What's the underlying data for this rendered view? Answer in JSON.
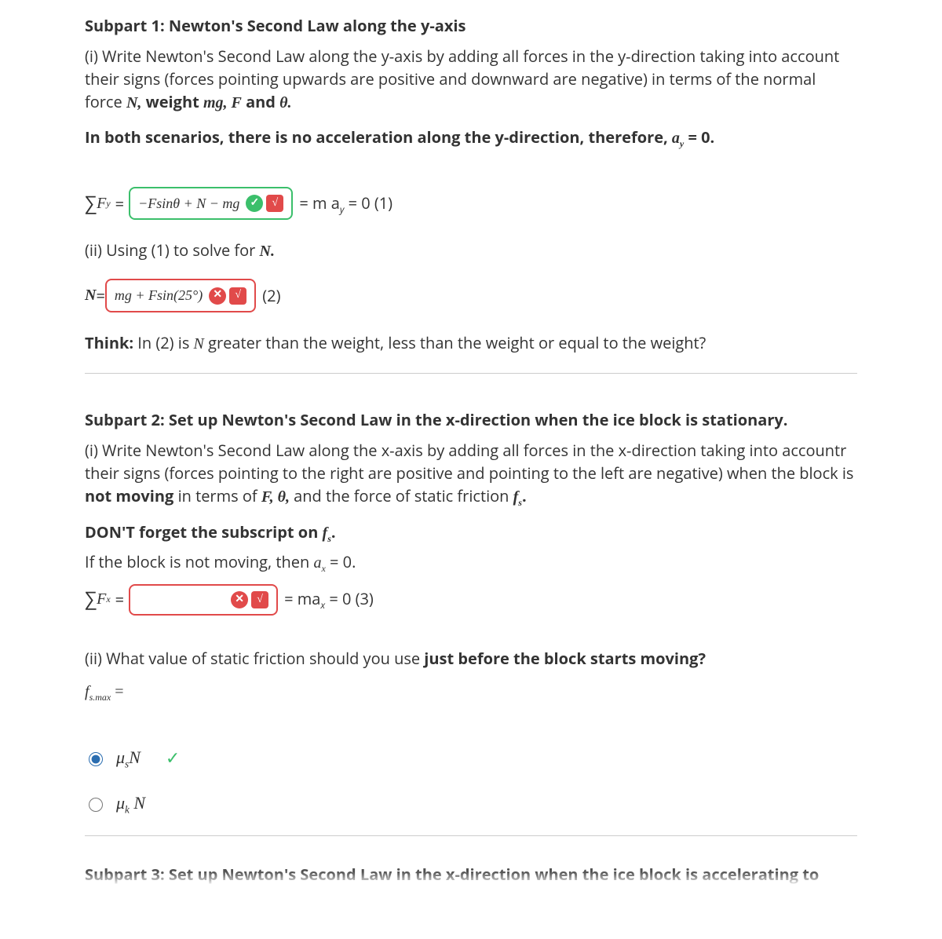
{
  "subpart1": {
    "title": "Subpart 1: Newton's Second Law along the y-axis",
    "p1_pre": "(i) Write Newton's Second Law along the y-axis by adding all forces in the y-direction taking into account their signs (forces pointing upwards are positive and downward are negative) in terms of the normal force ",
    "p1_N": "N,",
    "p1_weight": " weight ",
    "p1_mg": "mg, ",
    "p1_F": "F",
    "p1_and": " and ",
    "p1_theta": "θ.",
    "p2_pre": "In both scenarios, there is no acceleration along the y-direction, therefore, ",
    "p2_ay": "a",
    "p2_aysub": "y",
    "p2_eq0": " = 0.",
    "eq1": {
      "lhs_sigma": "∑",
      "lhs_F": "F",
      "lhs_sub": "y",
      "lhs_eq": "=",
      "box_content": "−Fsinθ + N − mg",
      "after": "= m a",
      "after_sub": "y",
      "after_tail": " = 0 (1)"
    },
    "p3": "(ii) Using (1) to solve for ",
    "p3_N": "N.",
    "eq2": {
      "lhs_N": "N",
      "lhs_eq": " = ",
      "box_content": "mg + Fsin(25°)",
      "after": "(2)"
    },
    "think_label": "Think:",
    "think_text": " In (2) is ",
    "think_N": "N",
    "think_tail": " greater than the weight, less than the weight or equal to the weight?"
  },
  "subpart2": {
    "title": "Subpart 2: Set up Newton's Second Law in the x-direction when the ice block is stationary.",
    "p1_pre": "(i) Write Newton's Second Law along the x-axis by adding all forces in the x-direction taking into accountr their signs (forces pointing to the right are positive and pointing to the left are negative) when the block is ",
    "p1_notmoving": "not moving",
    "p1_mid": " in terms of ",
    "p1_F": "F, ",
    "p1_theta": "θ,",
    "p1_mid2": " and the force of static friction ",
    "p1_fs_f": "f",
    "p1_fs_s": "s",
    "p1_fs_tail": ".",
    "p2_pre": "DON'T forget the subscript on  ",
    "p2_fs_f": "f",
    "p2_fs_s": "s",
    "p2_tail": ".",
    "p3_pre": "If the block is not moving, then ",
    "p3_a": "a",
    "p3_sub": "x",
    "p3_tail": " = 0.",
    "eq3": {
      "lhs_sigma": "∑",
      "lhs_F": "F",
      "lhs_sub": "x",
      "lhs_eq": "=",
      "box_content": "",
      "after": "= ma",
      "after_sub": "x",
      "after_tail": " = 0 (3)"
    },
    "q2_pre": "(ii)  What value of static friction should you use ",
    "q2_bold": "just before the block starts moving?",
    "fsmax_f": "f",
    "fsmax_sub": "s.max",
    "fsmax_eq": " = ",
    "radio1_mu": "μ",
    "radio1_sub": "s",
    "radio1_N": "N",
    "radio2_mu": "μ",
    "radio2_sub": "k",
    "radio2_N": " N"
  },
  "subpart3": {
    "title": "Subpart 3: Set up Newton's Second Law in the x-direction when the ice block is accelerating to"
  },
  "icons": {
    "check_text": "✓",
    "cross_text": "✕",
    "help_text": "√"
  }
}
